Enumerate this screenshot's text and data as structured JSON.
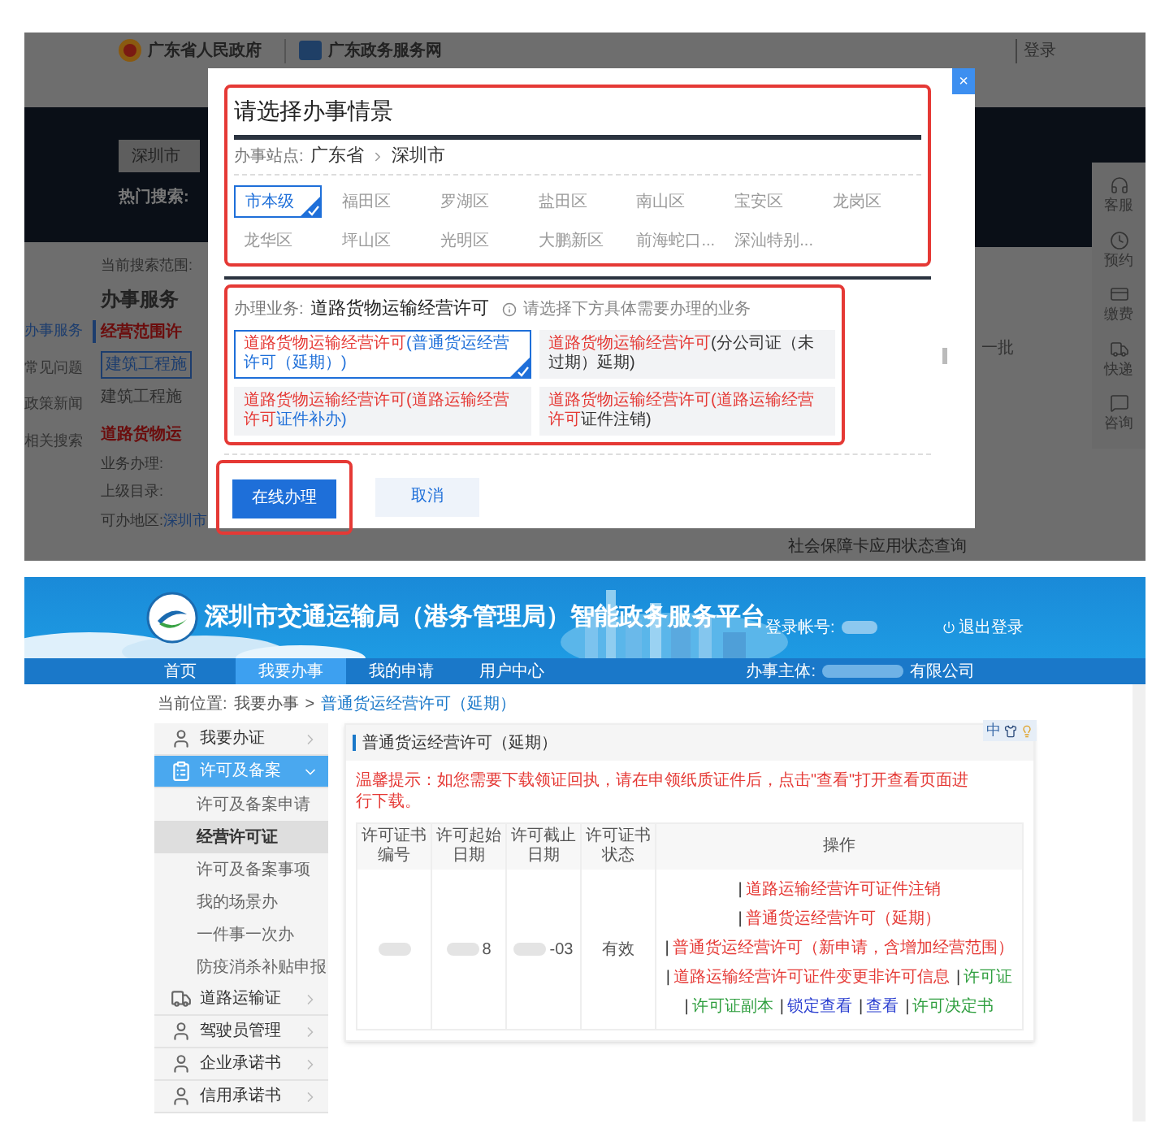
{
  "background_site": {
    "gov_title": "广东省人民政府",
    "portal_title": "广东政务服务网",
    "login": "登录",
    "city_select": "深圳市",
    "hot_search": "热门搜索:",
    "search_scope": "当前搜索范围:",
    "section_title": "办事服务",
    "side_items": [
      {
        "label": "办事服务",
        "selected": true
      },
      {
        "label": "常见问题",
        "selected": false
      },
      {
        "label": "政策新闻",
        "selected": false
      },
      {
        "label": "相关搜索",
        "selected": false
      }
    ],
    "scope_heading": "经营范围许",
    "category_tag": "建筑工程施",
    "bullet": "建筑工程施",
    "result_title": "道路货物运",
    "result_fields": [
      {
        "label": "业务办理:"
      },
      {
        "label": "上级目录:"
      },
      {
        "label": "可办地区:",
        "value": "深圳市"
      }
    ],
    "tools": [
      {
        "label": "客服",
        "kind": "headset"
      },
      {
        "label": "预约",
        "kind": "clock"
      },
      {
        "label": "缴费",
        "kind": "card"
      },
      {
        "label": "快递",
        "kind": "truck"
      },
      {
        "label": "咨询",
        "kind": "message"
      }
    ],
    "refresh": "一批",
    "bottom_item": "社会保障卡应用状态查询"
  },
  "dialog": {
    "title": "请选择办事情景",
    "close": "×",
    "station_label": "办事站点:",
    "station_path": [
      "广东省",
      "深圳市"
    ],
    "districts": [
      {
        "label": "市本级",
        "selected": true
      },
      {
        "label": "福田区",
        "selected": false
      },
      {
        "label": "罗湖区",
        "selected": false
      },
      {
        "label": "盐田区",
        "selected": false
      },
      {
        "label": "南山区",
        "selected": false
      },
      {
        "label": "宝安区",
        "selected": false
      },
      {
        "label": "龙岗区",
        "selected": false
      },
      {
        "label": "龙华区",
        "selected": false
      },
      {
        "label": "坪山区",
        "selected": false
      },
      {
        "label": "光明区",
        "selected": false
      },
      {
        "label": "大鹏新区",
        "selected": false
      },
      {
        "label": "前海蛇口...",
        "selected": false
      },
      {
        "label": "深汕特别...",
        "selected": false
      }
    ],
    "business_label": "办理业务:",
    "business_name": "道路货物运输经营许可",
    "hint": "请选择下方具体需要办理的业务",
    "options": [
      {
        "selected": true,
        "parts": [
          {
            "text": "道路货物运输经营许可",
            "color": "#e53935"
          },
          {
            "text": "(普通货运经营许可（延期）)",
            "color": "#1e6fd9"
          }
        ]
      },
      {
        "selected": false,
        "parts": [
          {
            "text": "道路货物运输经营许可",
            "color": "#e53935"
          },
          {
            "text": "(分公司证（未过期）延期)",
            "color": "#333333"
          }
        ]
      },
      {
        "selected": false,
        "parts": [
          {
            "text": "道路货物运输经营许可",
            "color": "#e53935"
          },
          {
            "text": "(道路运输经营许可",
            "color": "#e53935"
          },
          {
            "text": "证件补办)",
            "color": "#1e6fd9"
          }
        ]
      },
      {
        "selected": false,
        "parts": [
          {
            "text": "道路货物运输经营许可",
            "color": "#e53935"
          },
          {
            "text": "(道路运输经营许可",
            "color": "#e53935"
          },
          {
            "text": "证件注销)",
            "color": "#333333"
          }
        ]
      }
    ],
    "buttons": [
      {
        "label": "在线办理",
        "kind": "primary"
      },
      {
        "label": "取消",
        "kind": "secondary"
      }
    ]
  },
  "portal": {
    "title": "深圳市交通运输局（港务管理局）智能政务服务平台",
    "account_label": "登录帐号:",
    "logout": "退出登录",
    "nav": [
      {
        "label": "首页",
        "selected": false
      },
      {
        "label": "我要办事",
        "selected": true
      },
      {
        "label": "我的申请",
        "selected": false
      },
      {
        "label": "用户中心",
        "selected": false
      }
    ],
    "entity_label": "办事主体:",
    "entity_value": "有限公司",
    "breadcrumb": {
      "label": "当前位置:",
      "parent": "我要办事",
      "separator": ">",
      "current": "普通货运经营许可（延期）"
    },
    "sidebar": [
      {
        "label": "我要办证",
        "kind": "person",
        "expanded": false,
        "selected": false
      },
      {
        "label": "许可及备案",
        "kind": "clipboard",
        "expanded": true,
        "selected": true,
        "children": [
          {
            "label": "许可及备案申请",
            "selected": false
          },
          {
            "label": "经营许可证",
            "selected": true
          },
          {
            "label": "许可及备案事项",
            "selected": false
          },
          {
            "label": "我的场景办",
            "selected": false
          },
          {
            "label": "一件事一次办",
            "selected": false
          },
          {
            "label": "防疫消杀补贴申报",
            "selected": false
          }
        ]
      },
      {
        "label": "道路运输证",
        "kind": "truck",
        "expanded": false,
        "selected": false
      },
      {
        "label": "驾驶员管理",
        "kind": "person",
        "expanded": false,
        "selected": false
      },
      {
        "label": "企业承诺书",
        "kind": "person",
        "expanded": false,
        "selected": false
      },
      {
        "label": "信用承诺书",
        "kind": "person",
        "expanded": false,
        "selected": false
      }
    ],
    "float_tools": {
      "language": "中"
    },
    "card": {
      "title": "普通货运经营许可（延期）",
      "notice": "温馨提示：如您需要下载领证回执，请在申领纸质证件后，点击\"查看\"打开查看页面进行下载。",
      "table": {
        "columns": [
          "许可证书编号",
          "许可起始日期",
          "许可截止日期",
          "许可证书状态",
          "操作"
        ],
        "separator": "|",
        "rows": [
          {
            "cells": [
              {
                "redacted": true
              },
              {
                "redacted": true,
                "text": "8"
              },
              {
                "redacted": true,
                "text": "-03"
              },
              {
                "redacted": false,
                "text": "有效"
              }
            ],
            "actions": [
              {
                "text": "道路运输经营许可证件注销",
                "color": "#e53935"
              },
              {
                "text": "普通货运经营许可（延期）",
                "color": "#e53935"
              },
              {
                "text": "普通货运经营许可（新申请，含增加经营范围）",
                "color": "#e53935"
              },
              {
                "text": "道路运输经营许可证件变更非许可信息",
                "color": "#e53935"
              },
              {
                "text": "许可证",
                "color": "#2e9e3e"
              },
              {
                "text": "许可证副本",
                "color": "#2e9e3e"
              },
              {
                "text": "锁定查看",
                "color": "#2b3fd0"
              },
              {
                "text": "查看",
                "color": "#2b3fd0"
              },
              {
                "text": "许可决定书",
                "color": "#2e9e3e"
              }
            ]
          }
        ]
      }
    }
  }
}
